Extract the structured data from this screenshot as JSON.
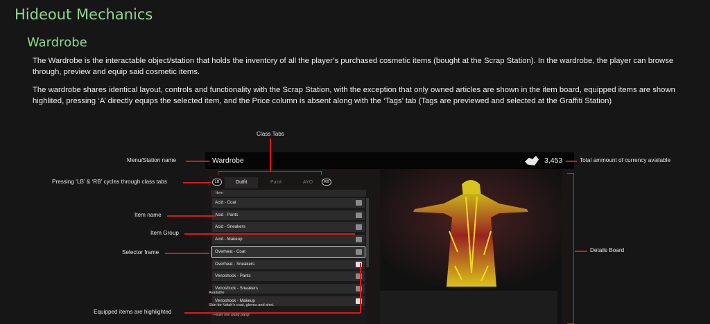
{
  "heading": "Hideout Mechanics",
  "section": "Wardrobe",
  "paragraphs": [
    "The Wardrobe is the interactable object/station that holds the inventory of all the player’s purchased cosmetic items (bought at the Scrap Station). In the wardrobe, the player can browse through, preview and equip said cosmetic items.",
    "The wardrobe shares identical layout, controls and functionality with the Scrap Station, with the exception that only owned articles are shown in the item board, equipped items are shown highlited, pressing ‘A’ directly equips the selected item, and the Price column is absent along with the ‘Tags’ tab (Tags are previewed and selected at the Graffiti Station)"
  ],
  "annotations": {
    "class_tabs": "Class Tabs",
    "menu_station_name": "Menu/Station name",
    "currency": "Total ammount of currency available",
    "cycle_tabs": "Pressing ‘LB’ & ‘RB’ cycles through class tabs",
    "item_name": "Item name",
    "item_group": "Item Group",
    "selector_frame": "Selector frame",
    "details_board": "Details Board",
    "equipped": "Equipped items are highlighted"
  },
  "game": {
    "station_name": "Wardrobe",
    "currency_icon": "currency-icon",
    "currency": "3,453",
    "lb": "LB",
    "rb": "RB",
    "tabs": [
      "Outfit",
      "Paint",
      "AYO"
    ],
    "list_header": "Item",
    "items": [
      "Acid - Coat",
      "Acid - Pants",
      "Acid - Sneakers",
      "Acid - Makeup",
      "Overheat - Coat",
      "Overheat - Sneakers",
      "Venoshock - Pants",
      "Venoshock - Sneakers",
      "Venoshock - Makeup"
    ],
    "available": "Available",
    "description": "Skin for Valah’s coat, gloves and shirt.",
    "quote": "- Feuer frei! Bang Bang!"
  },
  "colors": {
    "heading": "#8fd88f",
    "annotation_line": "#d41c1c",
    "background": "#161616"
  }
}
